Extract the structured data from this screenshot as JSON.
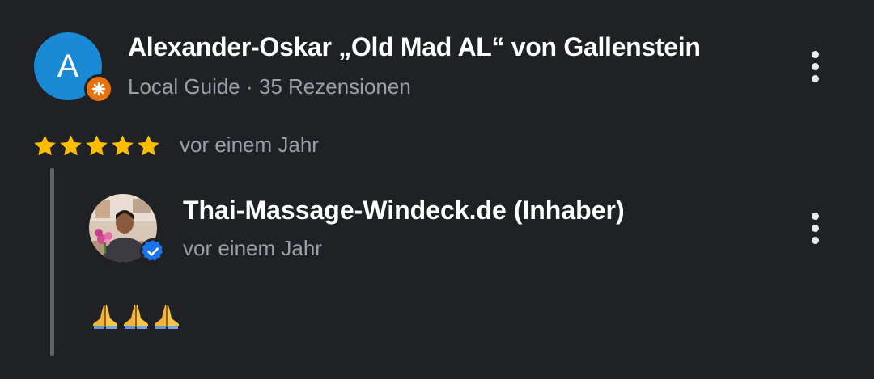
{
  "review": {
    "avatar_letter": "A",
    "avatar_color": "#1a8ad6",
    "badge_icon": "local-guide-star-icon",
    "badge_color": "#e8710a",
    "reviewer_name": "Alexander-Oskar „Old Mad AL“ von Gallenstein",
    "reviewer_meta": "Local Guide · 35 Rezensionen",
    "rating": 5,
    "rating_max": 5,
    "star_color": "#fbbc04",
    "date": "vor einem Jahr",
    "more_icon": "more-vert-icon"
  },
  "owner_reply": {
    "name": "Thai-Massage-Windeck.de (Inhaber)",
    "date": "vor einem Jahr",
    "verified_icon": "verified-check-icon",
    "verified_color": "#1a73e8",
    "text_icons": [
      "folded-hands-icon",
      "folded-hands-icon",
      "folded-hands-icon"
    ],
    "more_icon": "more-vert-icon"
  }
}
